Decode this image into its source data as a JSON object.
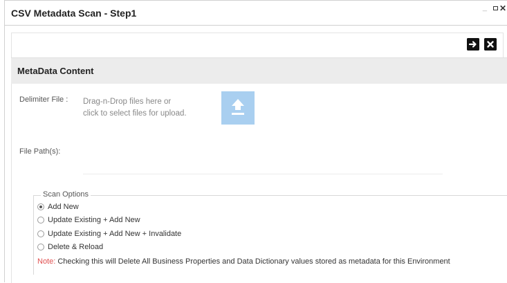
{
  "window": {
    "title": "CSV Metadata Scan - Step1",
    "controls": {
      "minimize": "_",
      "maximize": "□",
      "close": "✕"
    }
  },
  "toolbar": {
    "next_icon": "arrow-right-icon",
    "close_icon": "close-icon",
    "next_glyph": "➔",
    "close_glyph": "✖"
  },
  "section": {
    "title": "MetaData Content"
  },
  "delimiter": {
    "label": "Delimiter File :",
    "drop_line1": "Drag-n-Drop files here or",
    "drop_line2": "click to select files for upload.",
    "upload_icon": "upload-icon",
    "upload_color": "#a9cff0"
  },
  "file_path": {
    "label": "File Path(s):",
    "value": ""
  },
  "scan_options": {
    "legend": "Scan Options",
    "options": [
      {
        "label": "Add New",
        "selected": true
      },
      {
        "label": "Update Existing + Add New",
        "selected": false
      },
      {
        "label": "Update Existing + Add New + Invalidate",
        "selected": false
      },
      {
        "label": "Delete & Reload",
        "selected": false
      }
    ],
    "note_prefix": "Note:",
    "note_text": " Checking this will Delete All Business Properties and Data Dictionary values stored as metadata for this Environment",
    "note_color": "#e05050"
  }
}
